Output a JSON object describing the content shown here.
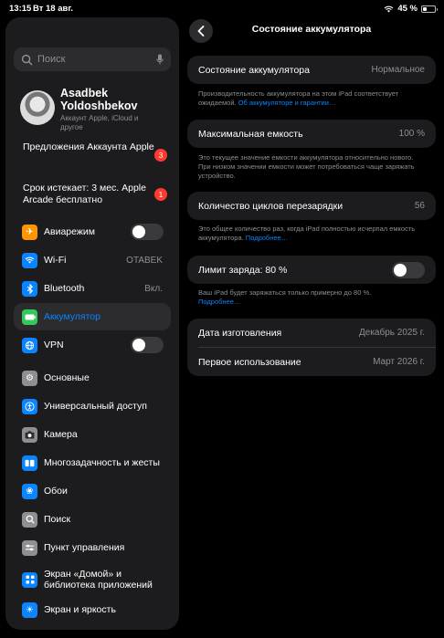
{
  "status": {
    "time": "13:15",
    "date": "Вт 18 авг.",
    "battery": "45 %",
    "battery_level": 0.45
  },
  "sidebar": {
    "search_placeholder": "Поиск",
    "profile": {
      "name": "Asadbek Yoldoshbekov",
      "subtitle": "Аккаунт Apple, iCloud и другое"
    },
    "promos": [
      {
        "label": "Предложения Аккаунта Apple",
        "badge": "3"
      },
      {
        "label": "Срок истекает: 3 мес. Apple Arcade бесплатно",
        "badge": "1"
      }
    ],
    "items": [
      {
        "label": "Авиарежим",
        "icon": "airplane-icon",
        "color": "#ff9500"
      },
      {
        "label": "Wi-Fi",
        "value": "OTABEK",
        "icon": "wifi-icon",
        "color": "#0a84ff"
      },
      {
        "label": "Bluetooth",
        "value": "Вкл.",
        "icon": "bluetooth-icon",
        "color": "#0a84ff"
      },
      {
        "label": "Аккумулятор",
        "icon": "battery-icon",
        "color": "#34c759"
      },
      {
        "label": "VPN",
        "icon": "vpn-icon",
        "color": "#0a84ff"
      },
      {
        "label": "Основные",
        "icon": "gear-icon",
        "color": "#8e8e93"
      },
      {
        "label": "Универсальный доступ",
        "icon": "accessibility-icon",
        "color": "#0a84ff"
      },
      {
        "label": "Камера",
        "icon": "camera-icon",
        "color": "#8e8e93"
      },
      {
        "label": "Многозадачность и жесты",
        "icon": "multitasking-icon",
        "color": "#0a84ff"
      },
      {
        "label": "Обои",
        "icon": "wallpaper-icon",
        "color": "#0a84ff"
      },
      {
        "label": "Поиск",
        "icon": "search-icon",
        "color": "#8e8e93"
      },
      {
        "label": "Пункт управления",
        "icon": "control-center-icon",
        "color": "#8e8e93"
      },
      {
        "label": "Экран «Домой» и библиотека приложений",
        "icon": "home-screen-icon",
        "color": "#0a84ff"
      },
      {
        "label": "Экран и яркость",
        "icon": "brightness-icon",
        "color": "#0a84ff"
      }
    ]
  },
  "detail": {
    "title": "Состояние аккумулятора",
    "health": {
      "label": "Состояние аккумулятора",
      "value": "Нормальное",
      "footer": "Производительность аккумулятора на этом iPad соответствует ожидаемой.",
      "footer_link": "Об аккумуляторе и гарантии…"
    },
    "capacity": {
      "label": "Максимальная емкость",
      "value": "100 %",
      "footer": "Это текущее значение емкости аккумулятора относительно нового. При низком значении емкости может потребоваться чаще заряжать устройство."
    },
    "cycles": {
      "label": "Количество циклов перезарядки",
      "value": "56",
      "footer": "Это общее количество раз, когда iPad полностью исчерпал емкость аккумулятора.",
      "footer_link": "Подробнее…"
    },
    "limit": {
      "label": "Лимит заряда: 80 %",
      "footer": "Ваш iPad будет заряжаться только примерно до 80 %.",
      "footer_link": "Подробнее…"
    },
    "dates": {
      "manufacture_label": "Дата изготовления",
      "manufacture_value": "Декабрь 2025 г.",
      "first_use_label": "Первое использование",
      "first_use_value": "Март 2026 г."
    }
  }
}
